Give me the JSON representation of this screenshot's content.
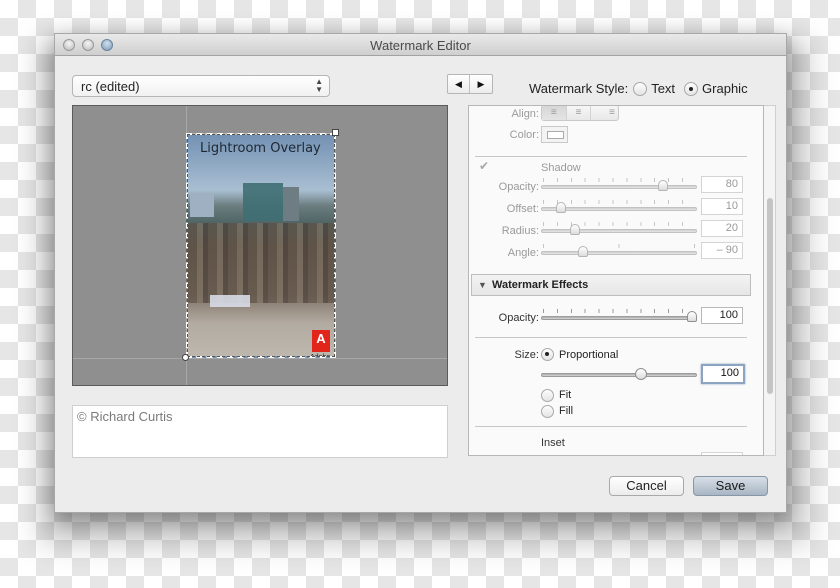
{
  "window": {
    "title": "Watermark Editor"
  },
  "preset": {
    "selected": "rc (edited)"
  },
  "navigation": {
    "prev_icon": "◀",
    "next_icon": "▶"
  },
  "watermark_style": {
    "label": "Watermark Style:",
    "options": [
      {
        "label": "Text",
        "selected": false
      },
      {
        "label": "Graphic",
        "selected": true
      }
    ]
  },
  "preview": {
    "overlay_text": "Lightroom Overlay",
    "logo_letter": "A",
    "logo_word": "Adobe"
  },
  "copyright_text": "© Richard Curtis",
  "text_options": {
    "align_label": "Align:",
    "align_options": [
      {
        "icon": "align-left-icon",
        "glyph": "≡",
        "selected": true
      },
      {
        "icon": "align-center-icon",
        "glyph": "≡",
        "selected": false
      },
      {
        "icon": "align-right-icon",
        "glyph": "≡",
        "selected": false
      }
    ],
    "color_label": "Color:"
  },
  "shadow": {
    "checkbox_glyph": "✔",
    "title": "Shadow",
    "enabled": true,
    "controls": [
      {
        "label": "Opacity:",
        "value": "80",
        "fraction": 0.8
      },
      {
        "label": "Offset:",
        "value": "10",
        "fraction": 0.1
      },
      {
        "label": "Radius:",
        "value": "20",
        "fraction": 0.2
      },
      {
        "label": "Angle:",
        "value": "– 90",
        "fraction": 0.25
      }
    ]
  },
  "watermark_effects": {
    "title": "Watermark Effects",
    "opacity_label": "Opacity:",
    "opacity_value": "100",
    "opacity_fraction": 1.0,
    "size_label": "Size:",
    "size_options": [
      {
        "label": "Proportional",
        "selected": true
      },
      {
        "label": "Fit",
        "selected": false
      },
      {
        "label": "Fill",
        "selected": false
      }
    ],
    "size_value": "100",
    "size_fraction": 0.65,
    "inset_title": "Inset"
  },
  "buttons": {
    "cancel": "Cancel",
    "save": "Save"
  }
}
